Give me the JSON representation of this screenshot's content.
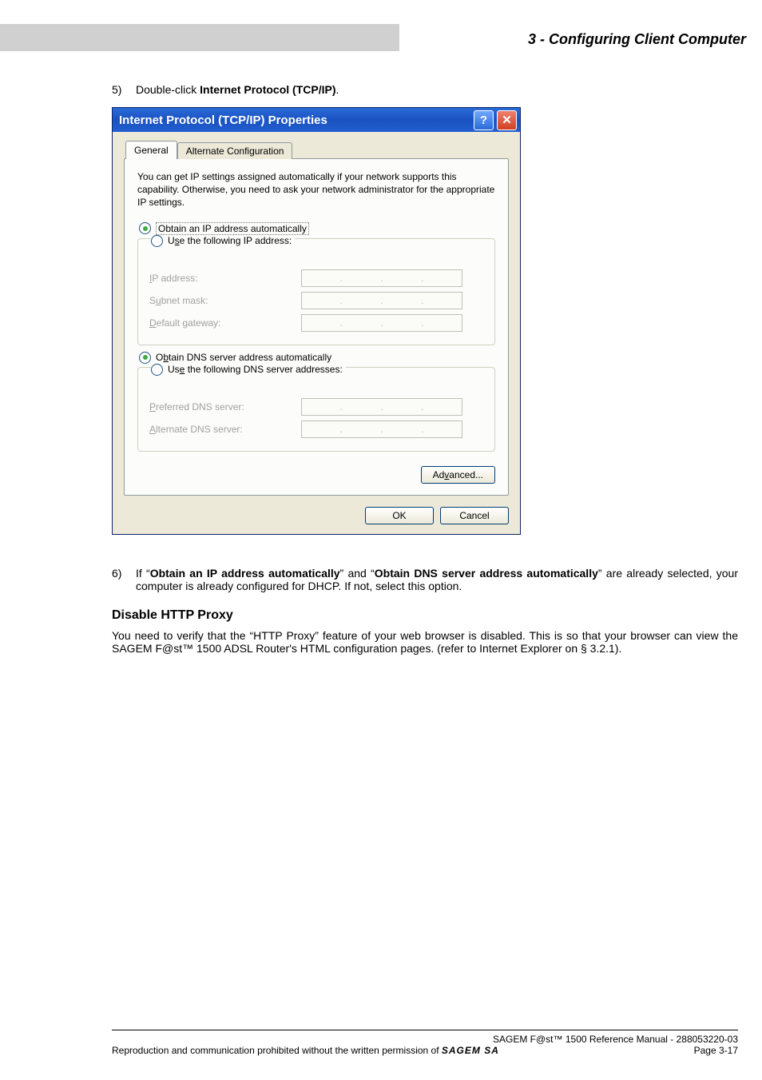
{
  "header": {
    "title": "3 - Configuring Client Computer"
  },
  "steps": {
    "five": {
      "num": "5)",
      "text_pre": "Double-click ",
      "text_bold": "Internet Protocol (TCP/IP)",
      "text_post": "."
    },
    "six": {
      "num": "6)",
      "pre": "If “",
      "b1": "Obtain an IP address automatically",
      "mid1": "” and “",
      "b2": "Obtain DNS server address automatically",
      "post": "” are already selected, your computer is already configured for DHCP. If not, select this option."
    }
  },
  "dialog": {
    "title": "Internet Protocol (TCP/IP) Properties",
    "help": "?",
    "close": "✕",
    "tabs": {
      "general": "General",
      "alt": "Alternate Configuration"
    },
    "desc": "You can get IP settings assigned automatically if your network supports this capability. Otherwise, you need to ask your network administrator for the appropriate IP settings.",
    "radios": {
      "obtain_ip": "Obtain an IP address automatically",
      "use_ip_pre": "U",
      "use_ip_u": "s",
      "use_ip_post": "e the following IP address:",
      "obtain_dns_pre": "O",
      "obtain_dns_u": "b",
      "obtain_dns_post": "tain DNS server address automatically",
      "use_dns_pre": "Us",
      "use_dns_u": "e",
      "use_dns_post": " the following DNS server addresses:"
    },
    "labels": {
      "ip_u": "I",
      "ip_post": "P address:",
      "subnet_pre": "S",
      "subnet_u": "u",
      "subnet_post": "bnet mask:",
      "gw_u": "D",
      "gw_post": "efault gateway:",
      "pdns_u": "P",
      "pdns_post": "referred DNS server:",
      "adns_u": "A",
      "adns_post": "lternate DNS server:"
    },
    "ip_dots": ".",
    "buttons": {
      "adv_pre": "Ad",
      "adv_u": "v",
      "adv_post": "anced...",
      "ok": "OK",
      "cancel": "Cancel"
    }
  },
  "section": {
    "heading": "Disable HTTP Proxy",
    "para": "You need to verify that the “HTTP Proxy” feature of your web browser is disabled. This is so that your browser can view the SAGEM F@st™ 1500 ADSL Router's HTML configuration pages. (refer to Internet Explorer on § 3.2.1)."
  },
  "footer": {
    "line1": "SAGEM F@st™ 1500 Reference Manual - 288053220-03",
    "line2_left": "Reproduction and communication prohibited without the written permission of ",
    "brand": "SAGEM SA",
    "page": "Page 3-17"
  }
}
